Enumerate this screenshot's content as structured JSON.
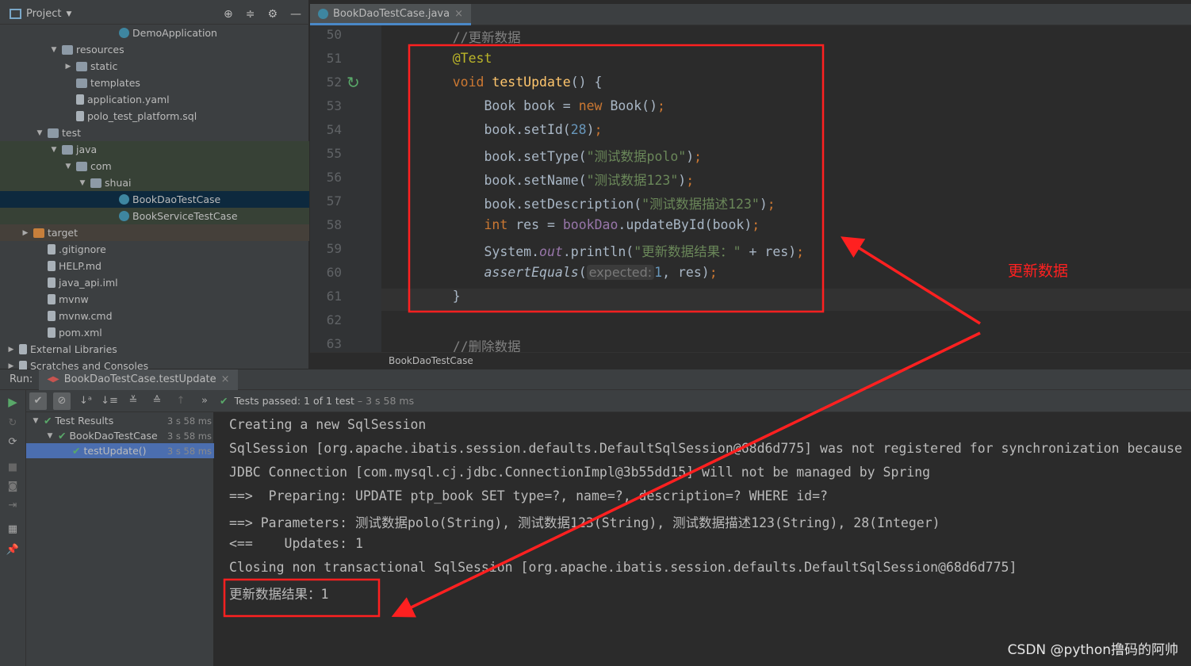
{
  "project": {
    "title": "Project",
    "tree": [
      {
        "label": "DemoApplication",
        "level": 7,
        "icon": "java-app-icon",
        "tri": ""
      },
      {
        "label": "resources",
        "level": 3,
        "icon": "folder-icon",
        "tri": "▼"
      },
      {
        "label": "static",
        "level": 4,
        "icon": "folder-icon",
        "tri": "▶"
      },
      {
        "label": "templates",
        "level": 4,
        "icon": "folder-icon",
        "tri": ""
      },
      {
        "label": "application.yaml",
        "level": 4,
        "icon": "yaml-file-icon",
        "tri": ""
      },
      {
        "label": "polo_test_platform.sql",
        "level": 4,
        "icon": "sql-file-icon",
        "tri": ""
      },
      {
        "label": "test",
        "level": 2,
        "icon": "folder-icon",
        "tri": "▼"
      },
      {
        "label": "java",
        "level": 3,
        "icon": "folder-icon",
        "tri": "▼"
      },
      {
        "label": "com",
        "level": 4,
        "icon": "folder-icon",
        "tri": "▼"
      },
      {
        "label": "shuai",
        "level": 5,
        "icon": "folder-icon",
        "tri": "▼"
      },
      {
        "label": "BookDaoTestCase",
        "level": 7,
        "icon": "java-class-icon",
        "tri": "",
        "selected": true
      },
      {
        "label": "BookServiceTestCase",
        "level": 7,
        "icon": "java-class-icon",
        "tri": ""
      },
      {
        "label": "target",
        "level": 1,
        "icon": "folder-icon",
        "tri": "▶",
        "excluded": true
      },
      {
        "label": ".gitignore",
        "level": 2,
        "icon": "file-icon",
        "tri": ""
      },
      {
        "label": "HELP.md",
        "level": 2,
        "icon": "file-icon",
        "tri": ""
      },
      {
        "label": "java_api.iml",
        "level": 2,
        "icon": "file-icon",
        "tri": ""
      },
      {
        "label": "mvnw",
        "level": 2,
        "icon": "file-icon",
        "tri": ""
      },
      {
        "label": "mvnw.cmd",
        "level": 2,
        "icon": "file-icon",
        "tri": ""
      },
      {
        "label": "pom.xml",
        "level": 2,
        "icon": "maven-icon",
        "tri": ""
      },
      {
        "label": "External Libraries",
        "level": 0,
        "icon": "library-icon",
        "tri": "▶"
      },
      {
        "label": "Scratches and Consoles",
        "level": 0,
        "icon": "scratch-icon",
        "tri": "▶"
      }
    ]
  },
  "editor": {
    "tab": "BookDaoTestCase.java",
    "breadcrumb": "BookDaoTestCase",
    "lines": [
      {
        "n": "50",
        "t": [
          [
            "    //更新数据",
            "cm"
          ]
        ]
      },
      {
        "n": "51",
        "t": [
          [
            "    @Test",
            "ann"
          ]
        ]
      },
      {
        "n": "52",
        "t": [
          [
            "    void ",
            "kw"
          ],
          [
            "testUpdate",
            "fn"
          ],
          [
            "() {",
            ""
          ]
        ]
      },
      {
        "n": "53",
        "t": [
          [
            "        Book book = ",
            ""
          ],
          [
            "new ",
            "kw"
          ],
          [
            "Book()",
            ""
          ],
          [
            ";",
            "kw"
          ]
        ]
      },
      {
        "n": "54",
        "t": [
          [
            "        book.setId(",
            ""
          ],
          [
            "28",
            "num"
          ],
          [
            ")",
            ""
          ],
          [
            ";",
            "kw"
          ]
        ]
      },
      {
        "n": "55",
        "t": [
          [
            "        book.setType(",
            ""
          ],
          [
            "\"测试数据polo\"",
            "str"
          ],
          [
            ")",
            ""
          ],
          [
            ";",
            "kw"
          ]
        ]
      },
      {
        "n": "56",
        "t": [
          [
            "        book.setName(",
            ""
          ],
          [
            "\"测试数据123\"",
            "str"
          ],
          [
            ")",
            ""
          ],
          [
            ";",
            "kw"
          ]
        ]
      },
      {
        "n": "57",
        "t": [
          [
            "        book.setDescription(",
            ""
          ],
          [
            "\"测试数据描述123\"",
            "str"
          ],
          [
            ")",
            ""
          ],
          [
            ";",
            "kw"
          ]
        ]
      },
      {
        "n": "58",
        "t": [
          [
            "        ",
            ""
          ],
          [
            "int ",
            "kw"
          ],
          [
            "res = ",
            ""
          ],
          [
            "bookDao",
            "fld"
          ],
          [
            ".updateById(book)",
            ""
          ],
          [
            ";",
            "kw"
          ]
        ]
      },
      {
        "n": "59",
        "t": [
          [
            "        System.",
            ""
          ],
          [
            "out",
            "sit"
          ],
          [
            ".println(",
            ""
          ],
          [
            "\"更新数据结果：\"",
            "str"
          ],
          [
            " + res)",
            ""
          ],
          [
            ";",
            "kw"
          ]
        ]
      },
      {
        "n": "60",
        "t": [
          [
            "        ",
            ""
          ],
          [
            "assertEquals",
            "it"
          ],
          [
            "(",
            ""
          ],
          [
            "expected:",
            "hint"
          ],
          [
            "1",
            "num"
          ],
          [
            ", res)",
            ""
          ],
          [
            ";",
            "kw"
          ]
        ]
      },
      {
        "n": "61",
        "t": [
          [
            "    }",
            ""
          ]
        ]
      },
      {
        "n": "62",
        "t": []
      },
      {
        "n": "63",
        "t": [
          [
            "    //删除数据",
            "cm"
          ]
        ]
      }
    ]
  },
  "run": {
    "label": "Run:",
    "tab": "BookDaoTestCase.testUpdate",
    "status": "Tests passed:",
    "status_count": "1 of 1 test",
    "status_time": "– 3 s 58 ms",
    "results": [
      {
        "label": "Test Results",
        "time": "3 s 58 ms",
        "level": 0
      },
      {
        "label": "BookDaoTestCase",
        "time": "3 s 58 ms",
        "level": 1
      },
      {
        "label": "testUpdate()",
        "time": "3 s 58 ms",
        "level": 2,
        "selected": true
      }
    ],
    "console": [
      "Creating a new SqlSession",
      "SqlSession [org.apache.ibatis.session.defaults.DefaultSqlSession@68d6d775] was not registered for synchronization because",
      "JDBC Connection [com.mysql.cj.jdbc.ConnectionImpl@3b55dd15] will not be managed by Spring",
      "==>  Preparing: UPDATE ptp_book SET type=?, name=?, description=? WHERE id=?",
      "==> Parameters: 测试数据polo(String), 测试数据123(String), 测试数据描述123(String), 28(Integer)",
      "<==    Updates: 1",
      "Closing non transactional SqlSession [org.apache.ibatis.session.defaults.DefaultSqlSession@68d6d775]",
      "更新数据结果：1"
    ]
  },
  "annotation": {
    "note": "更新数据",
    "color": "#ff2020"
  },
  "watermark": "CSDN @python撸码的阿帅"
}
